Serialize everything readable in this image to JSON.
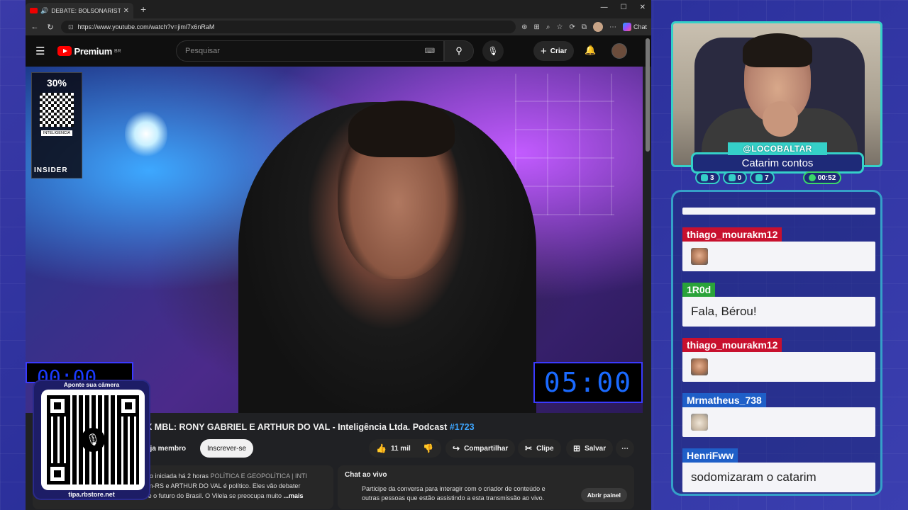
{
  "browser": {
    "tab_title": "DEBATE: BOLSONARISTA X M",
    "url": "https://www.youtube.com/watch?v=jiml7x6nRaM",
    "chat_label": "Chat"
  },
  "youtube": {
    "logo_text": "Premium",
    "region": "BR",
    "search_placeholder": "Pesquisar",
    "create_label": "Criar"
  },
  "video": {
    "ad_discount": "30%",
    "ad_brand": "INTELIGENCIA",
    "watermark": "INSIDER",
    "timer_right": "05:00",
    "timer_left": "00:00"
  },
  "video_info": {
    "title_prefix": "X MBL: RONY GABRIEL E ARTHUR DO VAL - Inteligência Ltda. Podcast ",
    "title_tag": "#1723",
    "member_label": "eja membro",
    "subscribe_label": "Inscrever-se",
    "likes": "11 mil",
    "share_label": "Compartilhar",
    "clip_label": "Clipe",
    "save_label": "Salvar",
    "desc_line1": "ão iniciada há 2 horas",
    "desc_hashtags": "POLÍTICA E GEOPOLÍTICA | INTI",
    "desc_line2": "im-RS e ARTHUR DO VAL é político. Eles vão debater",
    "desc_line3": "sobre Bolsonaro, a política de direita e o futuro do Brasil. O Vilela se preocupa muito",
    "desc_more": "...mais",
    "live_chat_title": "Chat ao vivo",
    "live_chat_text": "Participe da conversa para interagir com o criador de conteúdo e outras pessoas que estão assistindo a esta transmissão ao vivo.",
    "open_panel_label": "Abrir painel"
  },
  "qr_overlay": {
    "top_label": "Aponte sua câmera",
    "bottom_label": "tipa.rbstore.net"
  },
  "streamer": {
    "handle": "@LOCOBALTAR",
    "title": "Catarim contos",
    "stat_chat": "3",
    "stat_youtube": "0",
    "stat_viewers": "7",
    "stat_time": "00:52"
  },
  "chat": [
    {
      "user": "thiago_mourakm12",
      "user_color": "#c8102e",
      "message": "",
      "emote": "face"
    },
    {
      "user": "1R0d",
      "user_color": "#2aa33a",
      "message": "Fala, Bérou!",
      "emote": ""
    },
    {
      "user": "thiago_mourakm12",
      "user_color": "#c8102e",
      "message": "",
      "emote": "face"
    },
    {
      "user": "Mrmatheus_738",
      "user_color": "#1f5fc8",
      "message": "",
      "emote": "cat"
    },
    {
      "user": "HenriFww",
      "user_color": "#1f5fc8",
      "message": "sodomizaram o catarim",
      "emote": ""
    }
  ]
}
